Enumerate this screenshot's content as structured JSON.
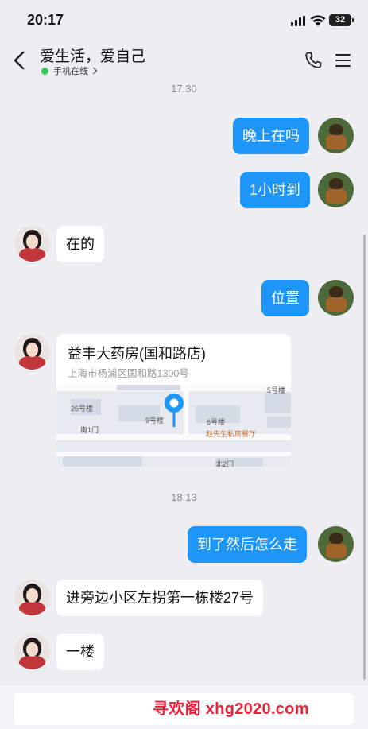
{
  "status_bar": {
    "time": "20:17",
    "battery": "32"
  },
  "header": {
    "title": "爱生活，爱自己",
    "online_status": "手机在线"
  },
  "messages": {
    "time1": "17:30",
    "m1": "晚上在吗",
    "m2": "1小时到",
    "m3": "在的",
    "m4": "位置",
    "location": {
      "name": "益丰大药房(国和路店)",
      "address": "上海市杨浦区国和路1300号",
      "map_labels": [
        "26号楼",
        "9号楼",
        "6号楼",
        "南1门",
        "赵先生私房餐厅",
        "北2门",
        "5号楼"
      ]
    },
    "time2": "18:13",
    "m5": "到了然后怎么走",
    "m6": "进旁边小区左拐第一栋楼27号",
    "m7": "一楼"
  },
  "watermark": "寻欢阁 xhg2020.com",
  "colors": {
    "outgoing_bubble": "#1e96f7",
    "incoming_bubble": "#ffffff",
    "background": "#eeeef2",
    "online_dot": "#34c759",
    "map_pin": "#1e96f7",
    "watermark": "#e8243a"
  }
}
